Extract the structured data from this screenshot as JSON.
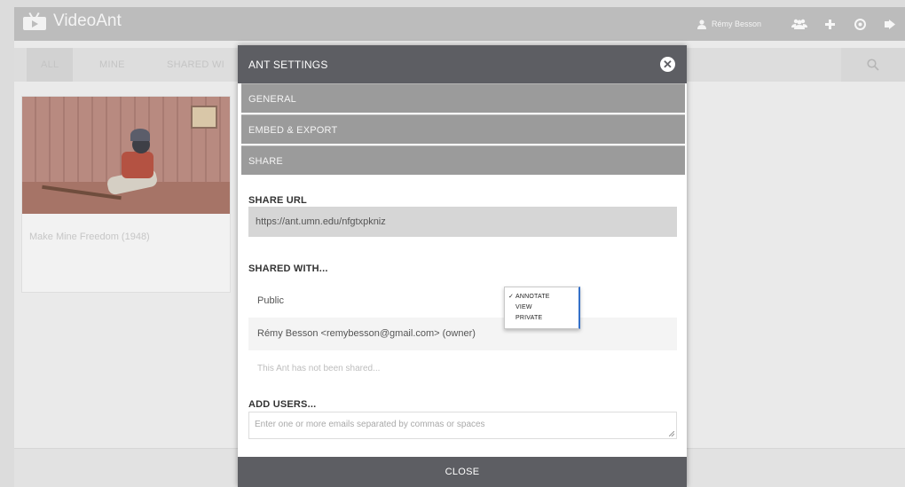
{
  "app": {
    "name": "VideoAnt",
    "user_name": "Rémy Besson",
    "top_icons": [
      "groups-icon",
      "plus-icon",
      "help-icon",
      "logout-icon"
    ]
  },
  "filters": {
    "tabs": [
      "ALL",
      "MINE",
      "SHARED WI"
    ],
    "active": "ALL",
    "search_icon": "search-icon"
  },
  "video_card": {
    "title": "Make Mine Freedom (1948)"
  },
  "modal": {
    "title": "ANT SETTINGS",
    "close_icon": "close-icon",
    "sections": [
      "GENERAL",
      "EMBED & EXPORT",
      "SHARE"
    ],
    "share_url_label": "SHARE URL",
    "share_url": "https://ant.umn.edu/nfgtxpkniz",
    "shared_with_label": "SHARED WITH...",
    "shared_rows": [
      {
        "name": "Public"
      },
      {
        "name": "Rémy Besson <remybesson@gmail.com> (owner)"
      }
    ],
    "not_shared_text": "This Ant has not been shared...",
    "permission_options": [
      "ANNOTATE",
      "VIEW",
      "PRIVATE"
    ],
    "permission_selected": "ANNOTATE",
    "add_users_label": "ADD USERS...",
    "add_users_placeholder": "Enter one or more emails separated by commas or spaces",
    "close_button": "CLOSE"
  },
  "colors": {
    "modal_header": "#5d5e63",
    "accordion": "#9b9b9b",
    "select_accent": "#3470c8"
  }
}
